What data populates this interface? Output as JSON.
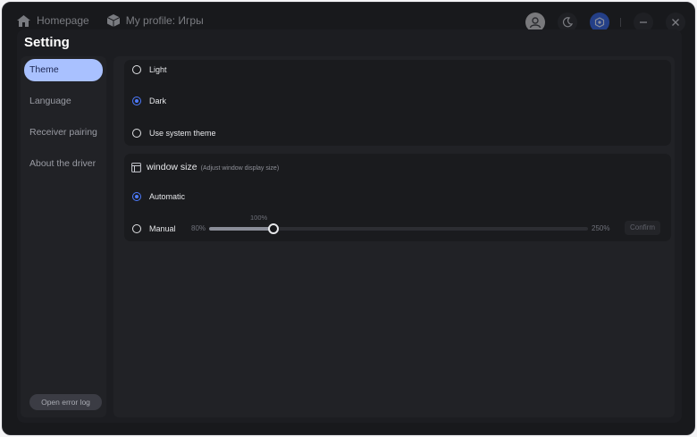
{
  "topbar": {
    "home_label": "Homepage",
    "profile_label": "My profile: Игры",
    "right_icons": [
      "user-icon",
      "moon-icon",
      "device-icon",
      "minimize-icon",
      "close-icon"
    ]
  },
  "dialog": {
    "title": "Setting",
    "sidebar": {
      "items": [
        {
          "label": "Theme",
          "active": true
        },
        {
          "label": "Language",
          "active": false
        },
        {
          "label": "Receiver pairing",
          "active": false
        },
        {
          "label": "About the driver",
          "active": false
        }
      ],
      "error_log_label": "Open error log"
    },
    "theme": {
      "options": [
        {
          "label": "Light",
          "checked": false
        },
        {
          "label": "Dark",
          "checked": true
        },
        {
          "label": "Use system theme",
          "checked": false
        }
      ]
    },
    "window_size": {
      "title": "window size",
      "hint": "(Adjust window display size)",
      "automatic_label": "Automatic",
      "manual_label": "Manual",
      "automatic_checked": true,
      "slider": {
        "min_label": "80%",
        "max_label": "250%",
        "value_label": "100%",
        "min": 80,
        "max": 250,
        "value": 100
      },
      "confirm_label": "Confirm"
    }
  },
  "colors": {
    "accent": "#4d7bff",
    "active_tab_bg": "#a9c1ff",
    "background": "#18191c"
  }
}
